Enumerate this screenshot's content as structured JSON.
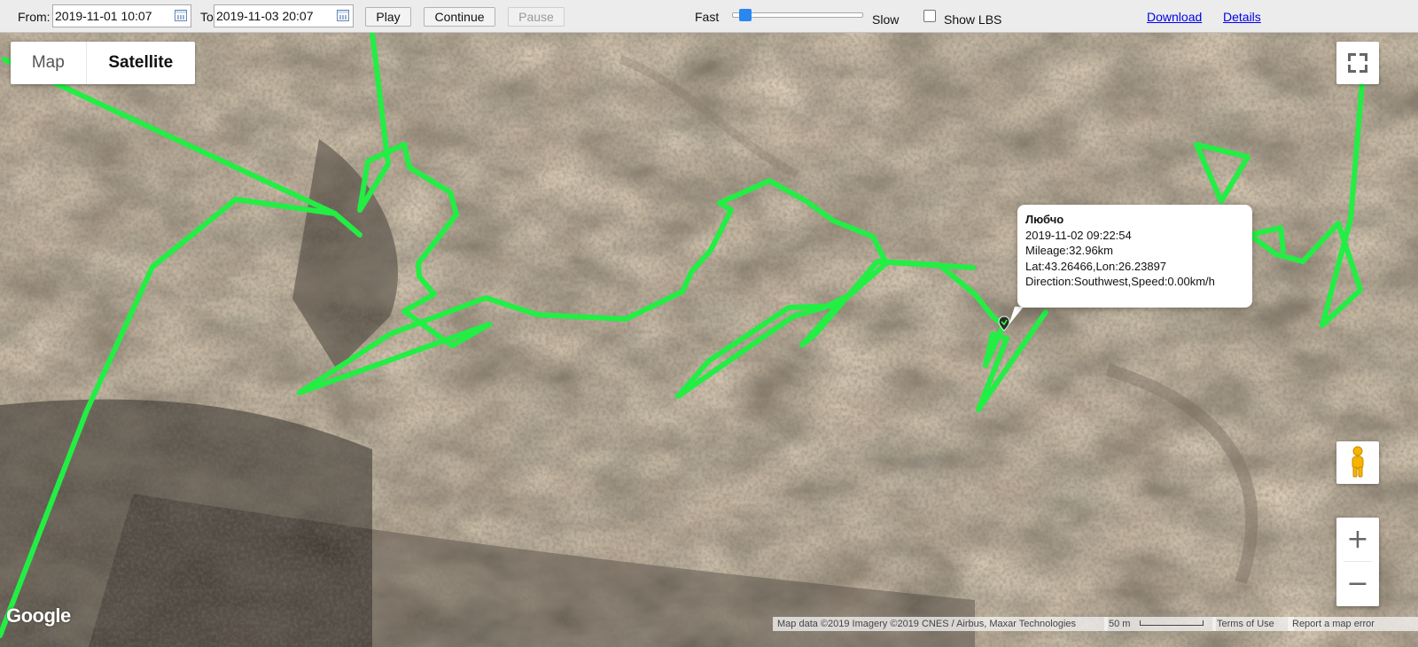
{
  "toolbar": {
    "from_label": "From:",
    "from_value": "2019-11-01 10:07",
    "to_label": "To",
    "to_value": "2019-11-03 20:07",
    "play_label": "Play",
    "continue_label": "Continue",
    "pause_label": "Pause",
    "fast_label": "Fast",
    "slow_label": "Slow",
    "show_lbs_label": "Show LBS",
    "show_lbs_checked": false,
    "download_label": "Download",
    "details_label": "Details"
  },
  "map": {
    "type_options": [
      "Map",
      "Satellite"
    ],
    "selected_type": "Satellite",
    "track_color": "#22ee44",
    "info": {
      "name": "Любчо",
      "time": "2019-11-02 09:22:54",
      "mileage": "Mileage:32.96km",
      "latlon": "Lat:43.26466,Lon:26.23897",
      "direction_speed": "Direction:Southwest,Speed:0.00km/h"
    },
    "zoom_in": "+",
    "zoom_out": "−",
    "google_logo": "Google",
    "attribution": "Map data ©2019 Imagery ©2019 CNES / Airbus, Maxar Technologies",
    "scale_label": "50 m",
    "terms": "Terms of Use",
    "report": "Report a map error"
  }
}
